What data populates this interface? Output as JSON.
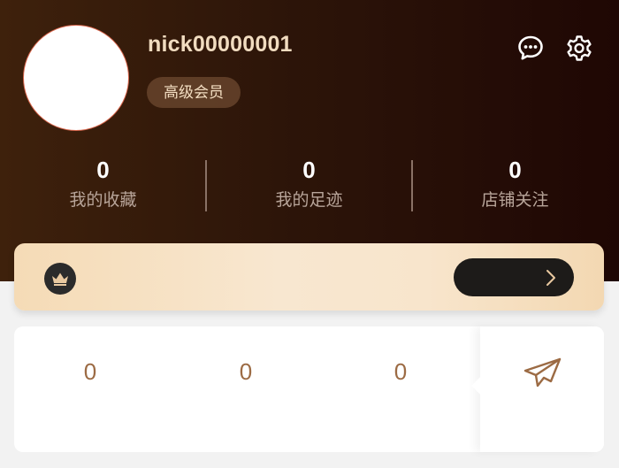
{
  "profile": {
    "username": "nick00000001",
    "badge": "高级会员"
  },
  "header_icons": [
    "chat-bubble-icon",
    "gear-icon"
  ],
  "stats": [
    {
      "value": "0",
      "label": "我的收藏"
    },
    {
      "value": "0",
      "label": "我的足迹"
    },
    {
      "value": "0",
      "label": "店铺关注"
    }
  ],
  "vip_card": {
    "icon": "crown-icon",
    "button_icon": "chevron-right-icon"
  },
  "counts": [
    "0",
    "0",
    "0"
  ],
  "send_icon": "paper-plane-icon",
  "colors": {
    "header_gradient_start": "#3e210c",
    "header_gradient_end": "#1f0704",
    "username": "#f1dcc0",
    "vip_card": "#f5dbb6",
    "count_text": "#9c6b44",
    "page_background": "#f2f2f2"
  }
}
